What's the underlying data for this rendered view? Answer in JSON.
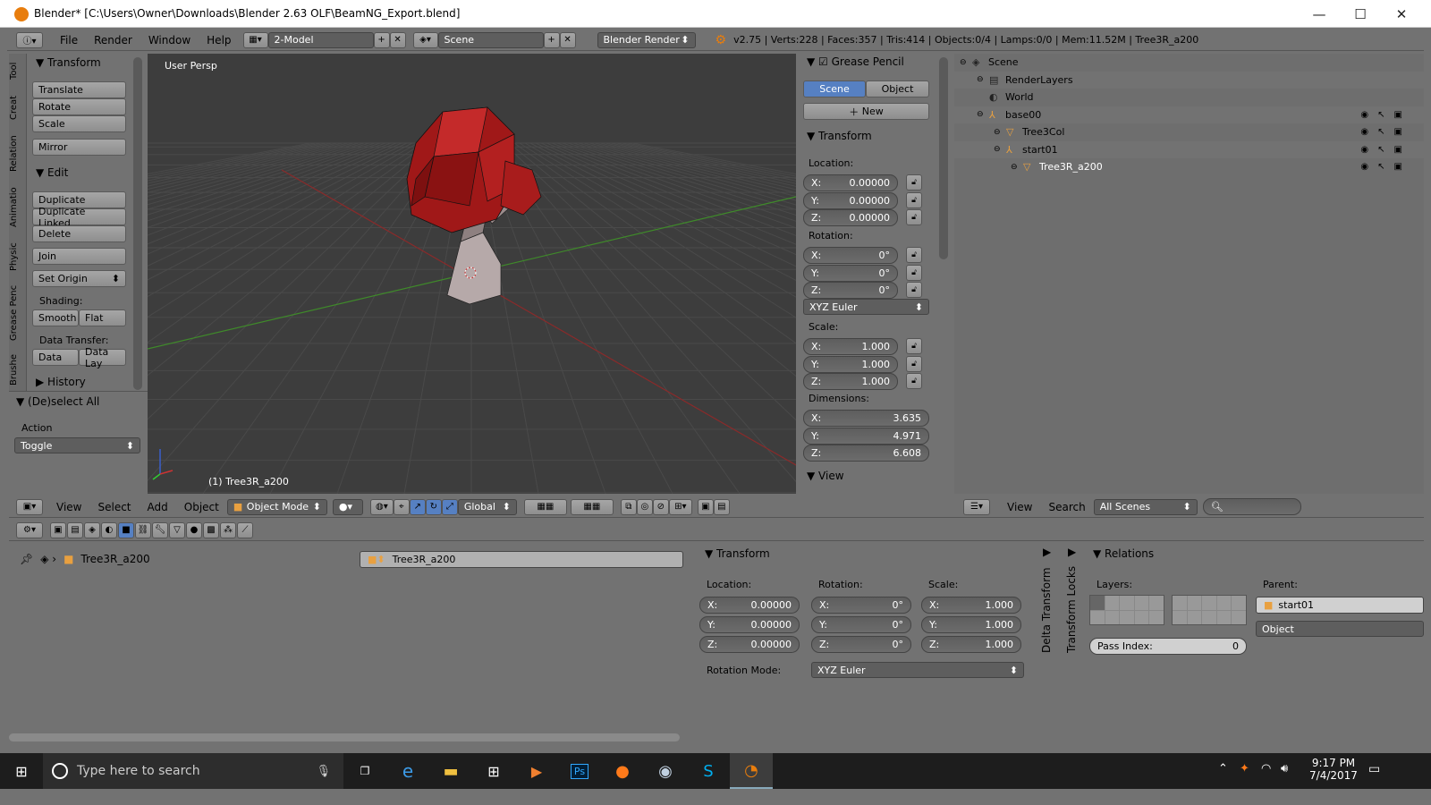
{
  "window": {
    "title": "Blender* [C:\\Users\\Owner\\Downloads\\Blender 2.63 OLF\\BeamNG_Export.blend]",
    "minimize": "—",
    "maximize": "☐",
    "close": "✕"
  },
  "info_header": {
    "menus": [
      "File",
      "Render",
      "Window",
      "Help"
    ],
    "layout": "2-Model",
    "scene": "Scene",
    "engine": "Blender Render",
    "stats": "v2.75 | Verts:228 | Faces:357 | Tris:414 | Objects:0/4 | Lamps:0/0 | Mem:11.52M | Tree3R_a200"
  },
  "tool_shelf": {
    "tabs": [
      "Tool",
      "Creat",
      "Relation",
      "Animatio",
      "Physic",
      "Grease Penc",
      "Brushe"
    ],
    "transform_header": "Transform",
    "transform_buttons": [
      "Translate",
      "Rotate",
      "Scale"
    ],
    "mirror": "Mirror",
    "edit_header": "Edit",
    "edit_buttons": [
      "Duplicate",
      "Duplicate Linked",
      "Delete"
    ],
    "join": "Join",
    "set_origin": "Set Origin",
    "shading_label": "Shading:",
    "smooth": "Smooth",
    "flat": "Flat",
    "data_transfer_label": "Data Transfer:",
    "data": "Data",
    "data_lay": "Data Lay",
    "history": "History"
  },
  "operator": {
    "title": "(De)select All",
    "action_label": "Action",
    "action_value": "Toggle"
  },
  "viewport": {
    "view_label": "User Persp",
    "object_label": "(1) Tree3R_a200"
  },
  "properties_n": {
    "grease_pencil": "Grease Pencil",
    "scene_tab": "Scene",
    "object_tab": "Object",
    "new": "New",
    "transform": "Transform",
    "location_label": "Location:",
    "location": [
      {
        "axis": "X:",
        "value": "0.00000"
      },
      {
        "axis": "Y:",
        "value": "0.00000"
      },
      {
        "axis": "Z:",
        "value": "0.00000"
      }
    ],
    "rotation_label": "Rotation:",
    "rotation": [
      {
        "axis": "X:",
        "value": "0°"
      },
      {
        "axis": "Y:",
        "value": "0°"
      },
      {
        "axis": "Z:",
        "value": "0°"
      }
    ],
    "rotation_mode": "XYZ Euler",
    "scale_label": "Scale:",
    "scale": [
      {
        "axis": "X:",
        "value": "1.000"
      },
      {
        "axis": "Y:",
        "value": "1.000"
      },
      {
        "axis": "Z:",
        "value": "1.000"
      }
    ],
    "dimensions_label": "Dimensions:",
    "dimensions": [
      {
        "axis": "X:",
        "value": "3.635"
      },
      {
        "axis": "Y:",
        "value": "4.971"
      },
      {
        "axis": "Z:",
        "value": "6.608"
      }
    ],
    "view": "View"
  },
  "outliner": {
    "items": [
      {
        "label": "Scene",
        "level": 0,
        "icon": "scene-icon"
      },
      {
        "label": "RenderLayers",
        "level": 1,
        "icon": "renderlayers-icon"
      },
      {
        "label": "World",
        "level": 1,
        "icon": "world-icon"
      },
      {
        "label": "base00",
        "level": 1,
        "icon": "empty-icon"
      },
      {
        "label": "Tree3Col",
        "level": 2,
        "icon": "mesh-icon"
      },
      {
        "label": "start01",
        "level": 2,
        "icon": "empty-icon"
      },
      {
        "label": "Tree3R_a200",
        "level": 3,
        "icon": "mesh-icon"
      }
    ],
    "menus": [
      "View",
      "Search"
    ],
    "filter": "All Scenes"
  },
  "view3d_header": {
    "menus": [
      "View",
      "Select",
      "Add",
      "Object"
    ],
    "mode": "Object Mode",
    "orientation": "Global"
  },
  "object_props": {
    "path_object": "Tree3R_a200",
    "name": "Tree3R_a200",
    "transform": "Transform",
    "location_label": "Location:",
    "rotation_label": "Rotation:",
    "scale_label": "Scale:",
    "loc": [
      {
        "axis": "X:",
        "value": "0.00000"
      },
      {
        "axis": "Y:",
        "value": "0.00000"
      },
      {
        "axis": "Z:",
        "value": "0.00000"
      }
    ],
    "rot": [
      {
        "axis": "X:",
        "value": "0°"
      },
      {
        "axis": "Y:",
        "value": "0°"
      },
      {
        "axis": "Z:",
        "value": "0°"
      }
    ],
    "scl": [
      {
        "axis": "X:",
        "value": "1.000"
      },
      {
        "axis": "Y:",
        "value": "1.000"
      },
      {
        "axis": "Z:",
        "value": "1.000"
      }
    ],
    "rotation_mode_label": "Rotation Mode:",
    "rotation_mode": "XYZ Euler",
    "delta_transform": "Delta Transform",
    "transform_locks": "Transform Locks",
    "relations": "Relations",
    "layers_label": "Layers:",
    "parent_label": "Parent:",
    "parent": "start01",
    "parent_type": "Object",
    "pass_index_label": "Pass Index:",
    "pass_index": "0"
  },
  "taskbar": {
    "search_placeholder": "Type here to search",
    "time": "9:17 PM",
    "date": "7/4/2017"
  },
  "colors": {
    "tree_red": "#a01818",
    "viewport_bg": "#3d3d3d",
    "selected_blue": "#5680c2",
    "grid_x": "#8a2a2a",
    "grid_y": "#3f8a2a"
  }
}
